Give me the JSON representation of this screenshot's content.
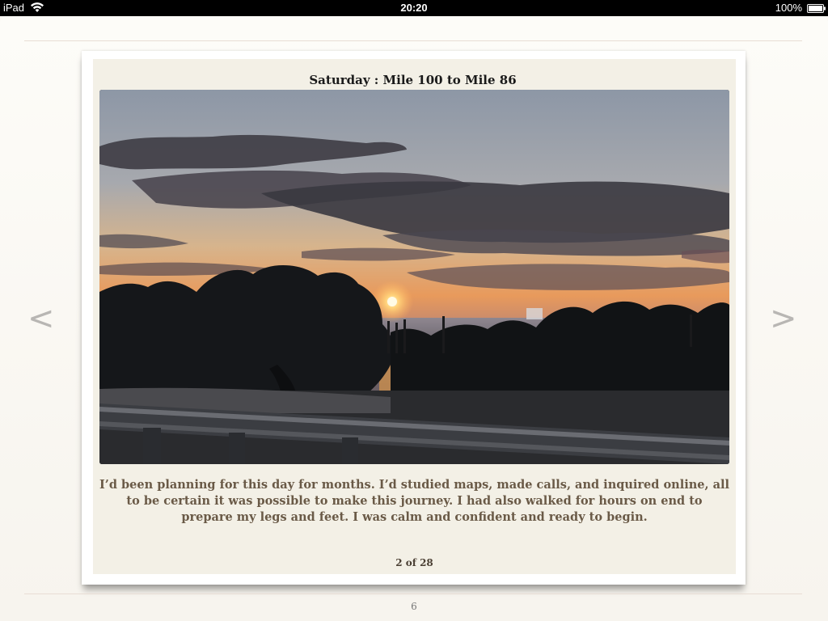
{
  "status_bar": {
    "device": "iPad",
    "time": "20:20",
    "battery": "100%"
  },
  "navigation": {
    "prev_label": "<",
    "next_label": ">"
  },
  "book_page": {
    "title": "Saturday : Mile 100 to Mile 86",
    "caption": "I’d been planning for this day for months. I’d studied maps, made calls, and inquired online, all to be certain it was possible to make this journey. I had also walked for hours on end to prepare my legs and feet. I was calm and confident and ready to begin.",
    "slide_counter": "2 of 28"
  },
  "page_number": "6",
  "icons": [
    "wifi-icon",
    "battery-icon",
    "chevron-left",
    "chevron-right"
  ]
}
